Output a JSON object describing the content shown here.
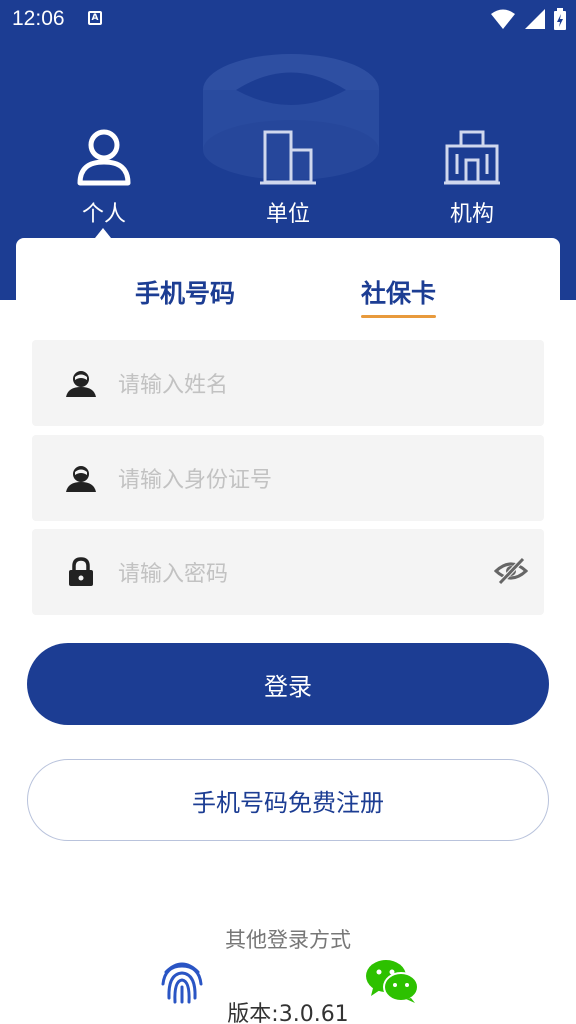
{
  "status_bar": {
    "time": "12:06",
    "notification_icon": "a-box-icon",
    "icons": [
      "wifi-icon",
      "signal-icon",
      "battery-icon"
    ]
  },
  "role_tabs": [
    {
      "label": "个人",
      "icon": "person-icon",
      "selected": true
    },
    {
      "label": "单位",
      "icon": "building-icon",
      "selected": false
    },
    {
      "label": "机构",
      "icon": "institution-icon",
      "selected": false
    }
  ],
  "login_tabs": [
    {
      "label": "手机号码",
      "selected": false
    },
    {
      "label": "社保卡",
      "selected": true
    }
  ],
  "fields": {
    "name": {
      "placeholder": "请输入姓名",
      "value": "",
      "icon": "user-icon"
    },
    "id_number": {
      "placeholder": "请输入身份证号",
      "value": "",
      "icon": "user-icon"
    },
    "password": {
      "placeholder": "请输入密码",
      "value": "",
      "icon": "lock-icon",
      "toggle_icon": "eye-off-icon"
    }
  },
  "buttons": {
    "login": "登录",
    "register": "手机号码免费注册"
  },
  "other_login": {
    "label": "其他登录方式",
    "methods": [
      "fingerprint-icon",
      "wechat-icon"
    ]
  },
  "version": "版本:3.0.61",
  "colors": {
    "primary": "#1c3d93",
    "accent": "#e89a3c",
    "field_bg": "#f4f4f4",
    "placeholder": "#c2c2c2",
    "wechat": "#2dc100"
  }
}
